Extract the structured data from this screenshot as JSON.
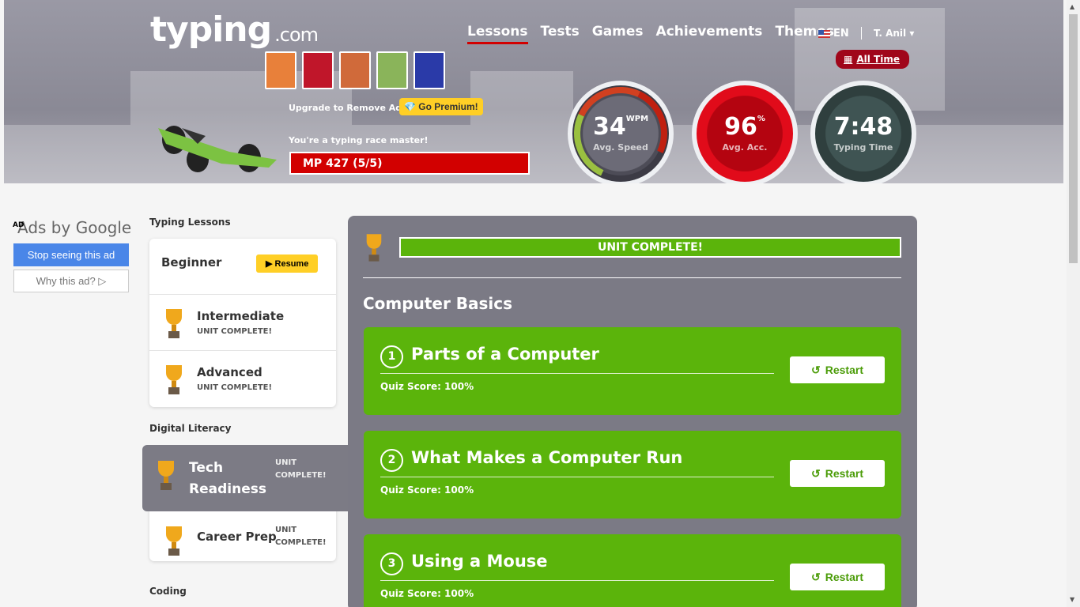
{
  "brand": {
    "name": "typing",
    "suffix": ".com"
  },
  "nav": [
    "Lessons",
    "Tests",
    "Games",
    "Achievements",
    "Themes"
  ],
  "lang": "EN",
  "user": "T. Anil",
  "alltime": "All Time",
  "upgrade": {
    "text": "Upgrade to Remove Ads:",
    "premium": "Go Premium!"
  },
  "master_text": "You're a typing race master!",
  "mp": "MP 427 (5/5)",
  "car_colors": [
    "#e8803a",
    "#c0162a",
    "#d06a3a",
    "#8ab45a",
    "#2a3aa8"
  ],
  "stats": {
    "speed": {
      "value": "34",
      "unit": "WPM",
      "label": "Avg. Speed"
    },
    "accuracy": {
      "value": "96",
      "unit": "%",
      "label": "Avg. Acc."
    },
    "time": {
      "value": "7:48",
      "label": "Typing Time"
    }
  },
  "ads": {
    "tag": "AD",
    "title": "Ads by Google",
    "stop": "Stop seeing this ad",
    "why": "Why this ad? ▷"
  },
  "sidebar": {
    "typing_lessons": "Typing Lessons",
    "beginner": "Beginner",
    "resume": "Resume",
    "intermediate": "Intermediate",
    "advanced": "Advanced",
    "unit_complete": "UNIT COMPLETE!",
    "digital_literacy": "Digital Literacy",
    "tech_readiness_1": "Tech",
    "tech_readiness_2": "Readiness",
    "unit_1": "UNIT",
    "unit_2": "COMPLETE!",
    "career_prep": "Career Prep",
    "coding": "Coding"
  },
  "main": {
    "banner": "UNIT COMPLETE!",
    "title": "Computer Basics",
    "restart": "Restart",
    "lessons": [
      {
        "num": "1",
        "title": "Parts of a Computer",
        "score": "Quiz Score: 100%"
      },
      {
        "num": "2",
        "title": "What Makes a Computer Run",
        "score": "Quiz Score: 100%"
      },
      {
        "num": "3",
        "title": "Using a Mouse",
        "score": "Quiz Score: 100%"
      }
    ]
  }
}
